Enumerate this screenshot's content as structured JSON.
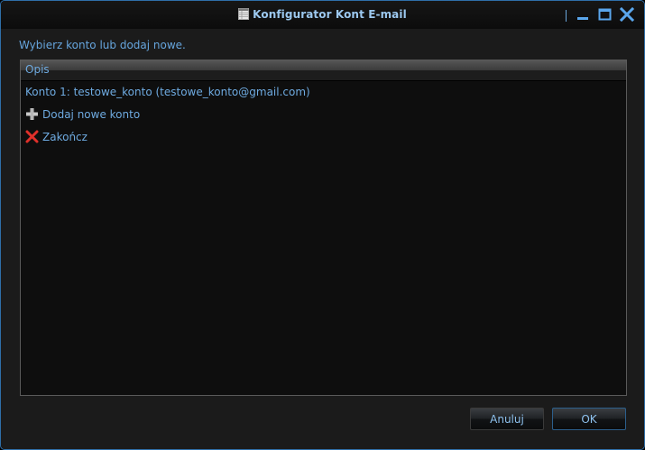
{
  "window": {
    "title": "Konfigurator Kont E-mail",
    "icons": {
      "app": "table-icon",
      "minimize": "minimize-icon",
      "maximize": "maximize-icon",
      "close": "close-icon"
    }
  },
  "main": {
    "prompt": "Wybierz konto lub dodaj nowe.",
    "list": {
      "column_header": "Opis",
      "items": [
        {
          "label": "Konto 1: testowe_konto (testowe_konto@gmail.com)",
          "icon": ""
        },
        {
          "label": "Dodaj nowe konto",
          "icon": "plus-icon"
        },
        {
          "label": "Zakończ",
          "icon": "red-x-icon"
        }
      ]
    }
  },
  "buttons": {
    "cancel_label": "Anuluj",
    "ok_label": "OK"
  },
  "colors": {
    "accent_text": "#6eaae0",
    "title_text": "#9cc8ef",
    "window_border": "#2f6fa8",
    "exit_icon": "#e0302a"
  }
}
